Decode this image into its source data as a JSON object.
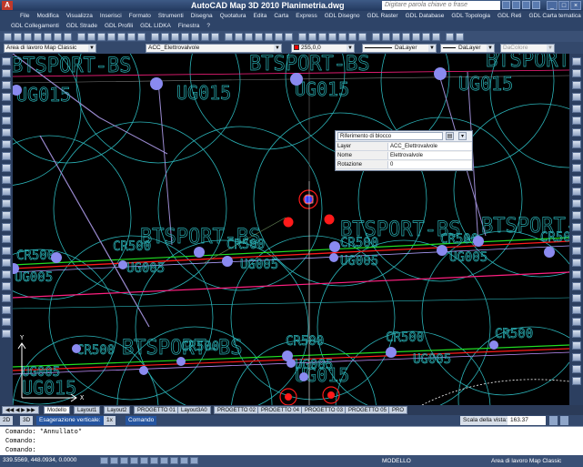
{
  "window": {
    "title": "AutoCAD Map 3D 2010   Planimetria.dwg",
    "search_placeholder": "Digitare parola chiave o frase",
    "controls": [
      "_",
      "□",
      "×"
    ]
  },
  "menu_primary": [
    "File",
    "Modifica",
    "Visualizza",
    "Inserisci",
    "Formato",
    "Strumenti",
    "Disegna",
    "Quotatura",
    "Edita",
    "Carta",
    "Express",
    "GDL Disegno",
    "GDL Raster",
    "GDL Database",
    "GDL Topologia",
    "GDL Reti",
    "GDL Carta tematica"
  ],
  "menu_secondary": [
    "GDL Collegamenti",
    "GDL Strade",
    "GDL Profili",
    "GDL LIDKA",
    "Finestra",
    "?"
  ],
  "toolbar2": {
    "workspace": "Area di lavoro Map Classic",
    "layer": "ACC_Elettrovalvole",
    "color": "255,0,0",
    "color_hex": "#ff0000",
    "linetype": "DaLayer",
    "lineweight": "DaLayer",
    "plotstyle": "DaColore"
  },
  "popup": {
    "title": "Riferimento di blocco",
    "rows": [
      {
        "key": "Layer",
        "value": "ACC_Elettrovalvole"
      },
      {
        "key": "Nome",
        "value": "Elettrovalvole"
      },
      {
        "key": "Rotazione",
        "value": "0"
      }
    ]
  },
  "drawing_labels": {
    "btsport": "BTSPORT-BS",
    "ug015": "UG015",
    "ug005": "UG005",
    "cr500": "CR500"
  },
  "tabs": [
    "Modello",
    "Layout1",
    "Layout2",
    "PROGETTO 01",
    "Layout3A0",
    "PROGETTO 02",
    "PROGETTO 04",
    "PROGETTO 03",
    "PROGETTO 05",
    "PRO"
  ],
  "status_top": {
    "mode_2d": "2D",
    "mode_3d": "3D",
    "vertical_exag": "Esagerazione verticale:",
    "vertical_exag_val": "1x",
    "cmd_label": "Comando",
    "scale_label": "Scala della vista:",
    "scale_value": "163.37"
  },
  "command_lines": [
    "Comando: *Annullato*",
    "Comando:",
    "Comando:"
  ],
  "status_bottom": {
    "coords": "339.5569, 448.0934, 0.0000",
    "model": "MODELLO",
    "workspace": "Area di lavoro Map Classic"
  },
  "colors": {
    "canvas": "#000000",
    "cyan": "#2bb3b8",
    "node": "#8a8af0",
    "red": "#ff1a1a",
    "green": "#22dd22",
    "magenta": "#ff2080"
  }
}
